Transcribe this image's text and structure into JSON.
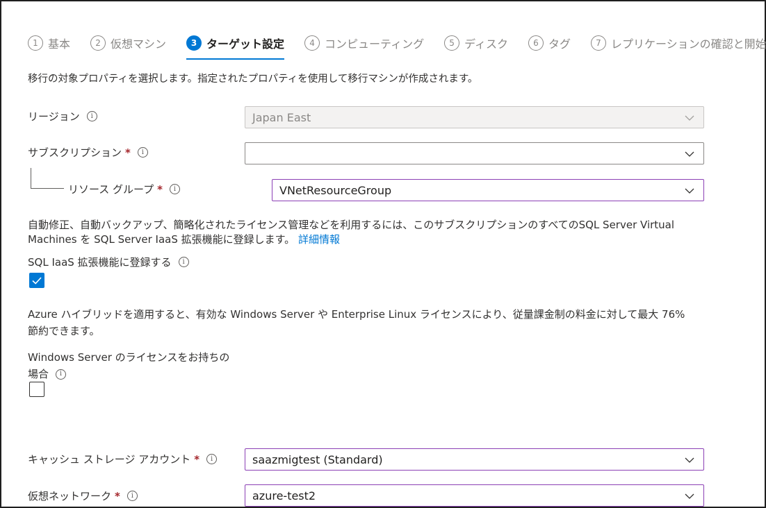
{
  "steps": [
    {
      "num": "1",
      "label": "基本"
    },
    {
      "num": "2",
      "label": "仮想マシン"
    },
    {
      "num": "3",
      "label": "ターゲット設定"
    },
    {
      "num": "4",
      "label": "コンピューティング"
    },
    {
      "num": "5",
      "label": "ディスク"
    },
    {
      "num": "6",
      "label": "タグ"
    },
    {
      "num": "7",
      "label": "レプリケーションの確認と開始"
    }
  ],
  "active_step": "3",
  "intro": "移行の対象プロパティを選択します。指定されたプロパティを使用して移行マシンが作成されます。",
  "region": {
    "label": "リージョン",
    "value": "Japan East",
    "disabled": true
  },
  "subscription": {
    "label": "サブスクリプション",
    "value": ""
  },
  "resource_group": {
    "label": "リソース グループ",
    "value": "VNetResourceGroup"
  },
  "sql": {
    "text": "自動修正、自動バックアップ、簡略化されたライセンス管理などを利用するには、このサブスクリプションのすべてのSQL Server Virtual Machines を SQL Server IaaS 拡張機能に登録します。",
    "link": "詳細情報",
    "checkbox_label": "SQL IaaS 拡張機能に登録する",
    "checked": true
  },
  "hybrid": {
    "text_line1": "Azure ハイブリッドを適用すると、有効な Windows Server や Enterprise Linux ライセンスにより、従量課金制の料金に対して最大 76%",
    "text_line2": "節約できます。",
    "checkbox_label_line1": "Windows Server のライセンスをお持ちの",
    "checkbox_label_line2": "場合",
    "checked": false
  },
  "cache_storage": {
    "label": "キャッシュ ストレージ アカウント",
    "value": "saazmigtest (Standard)"
  },
  "virtual_network": {
    "label": "仮想ネットワーク",
    "value": "azure-test2"
  },
  "required_mark": "*",
  "info_glyph": "i",
  "colors": {
    "accent": "#0078d4",
    "focus_border": "#8b3fb5",
    "required": "#a4262c"
  }
}
